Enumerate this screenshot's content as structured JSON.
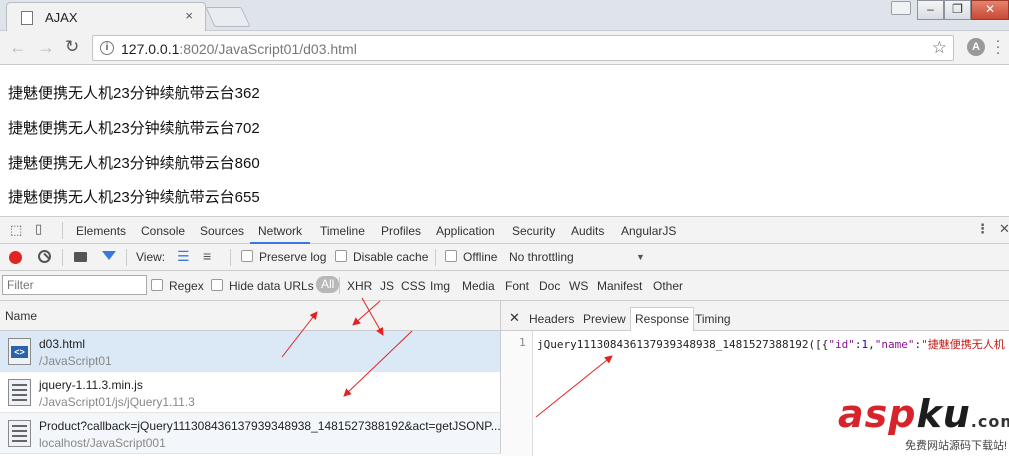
{
  "browser": {
    "tab_title": "AJAX",
    "tab_close": "×",
    "url_host": "127.0.0.1",
    "url_rest": ":8020/JavaScript01/d03.html",
    "extension_letter": "A"
  },
  "page": {
    "lines": [
      "捷魅便携无人机23分钟续航带云台362",
      "捷魅便携无人机23分钟续航带云台702",
      "捷魅便携无人机23分钟续航带云台860",
      "捷魅便携无人机23分钟续航带云台655"
    ]
  },
  "devtools": {
    "tabs": [
      "Elements",
      "Console",
      "Sources",
      "Network",
      "Timeline",
      "Profiles",
      "Application",
      "Security",
      "Audits",
      "AngularJS"
    ],
    "active_tab": "Network",
    "controls": {
      "view_label": "View:",
      "preserve_log": "Preserve log",
      "disable_cache": "Disable cache",
      "offline": "Offline",
      "throttling": "No throttling"
    },
    "filter": {
      "placeholder": "Filter",
      "regex": "Regex",
      "hide_data_urls": "Hide data URLs",
      "types": [
        "All",
        "XHR",
        "JS",
        "CSS",
        "Img",
        "Media",
        "Font",
        "Doc",
        "WS",
        "Manifest",
        "Other"
      ]
    },
    "requests_header": "Name",
    "requests": [
      {
        "name": "d03.html",
        "path": "/JavaScript01"
      },
      {
        "name": "jquery-1.11.3.min.js",
        "path": "/JavaScript01/js/jQuery1.11.3"
      },
      {
        "name": "Product?callback=jQuery111308436137939348938_1481527388192&act=getJSONP...",
        "path": "localhost/JavaScript001"
      }
    ],
    "detail_tabs": [
      "Headers",
      "Preview",
      "Response",
      "Timing"
    ],
    "active_detail_tab": "Response",
    "response": {
      "line_number": "1",
      "prefix": "jQuery111308436137939348938_1481527388192([{",
      "key1": "\"id\"",
      "val1": "1",
      "key2": "\"name\"",
      "val2": "\"捷魅便携无人机"
    }
  },
  "watermark": {
    "main_a": "asp",
    "main_b": "ku",
    "suffix": ".com",
    "sub": "免费网站源码下载站!"
  }
}
